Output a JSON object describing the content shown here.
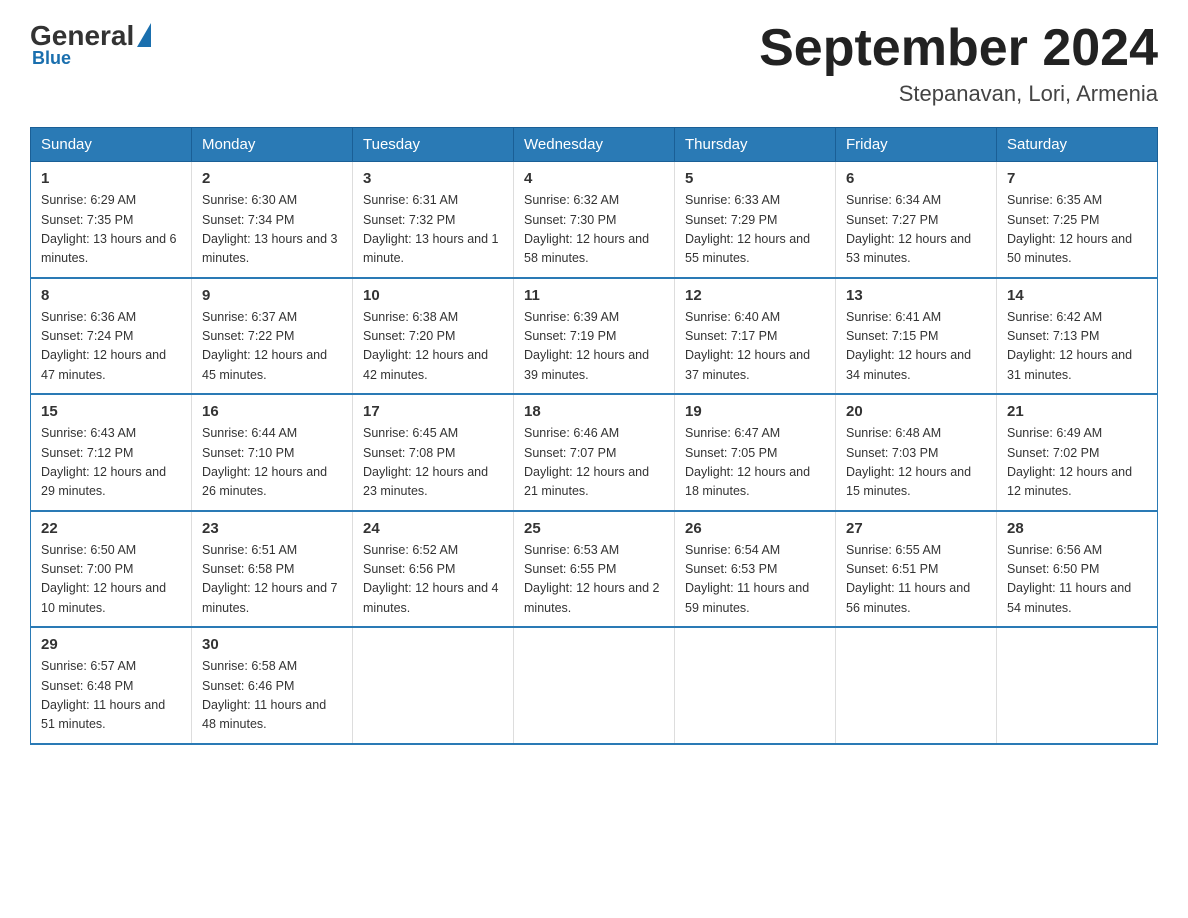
{
  "logo": {
    "general": "General",
    "blue": "Blue",
    "subtitle": "Blue"
  },
  "title": {
    "month_year": "September 2024",
    "location": "Stepanavan, Lori, Armenia"
  },
  "header_days": [
    "Sunday",
    "Monday",
    "Tuesday",
    "Wednesday",
    "Thursday",
    "Friday",
    "Saturday"
  ],
  "weeks": [
    [
      {
        "day": "1",
        "sunrise": "6:29 AM",
        "sunset": "7:35 PM",
        "daylight": "13 hours and 6 minutes."
      },
      {
        "day": "2",
        "sunrise": "6:30 AM",
        "sunset": "7:34 PM",
        "daylight": "13 hours and 3 minutes."
      },
      {
        "day": "3",
        "sunrise": "6:31 AM",
        "sunset": "7:32 PM",
        "daylight": "13 hours and 1 minute."
      },
      {
        "day": "4",
        "sunrise": "6:32 AM",
        "sunset": "7:30 PM",
        "daylight": "12 hours and 58 minutes."
      },
      {
        "day": "5",
        "sunrise": "6:33 AM",
        "sunset": "7:29 PM",
        "daylight": "12 hours and 55 minutes."
      },
      {
        "day": "6",
        "sunrise": "6:34 AM",
        "sunset": "7:27 PM",
        "daylight": "12 hours and 53 minutes."
      },
      {
        "day": "7",
        "sunrise": "6:35 AM",
        "sunset": "7:25 PM",
        "daylight": "12 hours and 50 minutes."
      }
    ],
    [
      {
        "day": "8",
        "sunrise": "6:36 AM",
        "sunset": "7:24 PM",
        "daylight": "12 hours and 47 minutes."
      },
      {
        "day": "9",
        "sunrise": "6:37 AM",
        "sunset": "7:22 PM",
        "daylight": "12 hours and 45 minutes."
      },
      {
        "day": "10",
        "sunrise": "6:38 AM",
        "sunset": "7:20 PM",
        "daylight": "12 hours and 42 minutes."
      },
      {
        "day": "11",
        "sunrise": "6:39 AM",
        "sunset": "7:19 PM",
        "daylight": "12 hours and 39 minutes."
      },
      {
        "day": "12",
        "sunrise": "6:40 AM",
        "sunset": "7:17 PM",
        "daylight": "12 hours and 37 minutes."
      },
      {
        "day": "13",
        "sunrise": "6:41 AM",
        "sunset": "7:15 PM",
        "daylight": "12 hours and 34 minutes."
      },
      {
        "day": "14",
        "sunrise": "6:42 AM",
        "sunset": "7:13 PM",
        "daylight": "12 hours and 31 minutes."
      }
    ],
    [
      {
        "day": "15",
        "sunrise": "6:43 AM",
        "sunset": "7:12 PM",
        "daylight": "12 hours and 29 minutes."
      },
      {
        "day": "16",
        "sunrise": "6:44 AM",
        "sunset": "7:10 PM",
        "daylight": "12 hours and 26 minutes."
      },
      {
        "day": "17",
        "sunrise": "6:45 AM",
        "sunset": "7:08 PM",
        "daylight": "12 hours and 23 minutes."
      },
      {
        "day": "18",
        "sunrise": "6:46 AM",
        "sunset": "7:07 PM",
        "daylight": "12 hours and 21 minutes."
      },
      {
        "day": "19",
        "sunrise": "6:47 AM",
        "sunset": "7:05 PM",
        "daylight": "12 hours and 18 minutes."
      },
      {
        "day": "20",
        "sunrise": "6:48 AM",
        "sunset": "7:03 PM",
        "daylight": "12 hours and 15 minutes."
      },
      {
        "day": "21",
        "sunrise": "6:49 AM",
        "sunset": "7:02 PM",
        "daylight": "12 hours and 12 minutes."
      }
    ],
    [
      {
        "day": "22",
        "sunrise": "6:50 AM",
        "sunset": "7:00 PM",
        "daylight": "12 hours and 10 minutes."
      },
      {
        "day": "23",
        "sunrise": "6:51 AM",
        "sunset": "6:58 PM",
        "daylight": "12 hours and 7 minutes."
      },
      {
        "day": "24",
        "sunrise": "6:52 AM",
        "sunset": "6:56 PM",
        "daylight": "12 hours and 4 minutes."
      },
      {
        "day": "25",
        "sunrise": "6:53 AM",
        "sunset": "6:55 PM",
        "daylight": "12 hours and 2 minutes."
      },
      {
        "day": "26",
        "sunrise": "6:54 AM",
        "sunset": "6:53 PM",
        "daylight": "11 hours and 59 minutes."
      },
      {
        "day": "27",
        "sunrise": "6:55 AM",
        "sunset": "6:51 PM",
        "daylight": "11 hours and 56 minutes."
      },
      {
        "day": "28",
        "sunrise": "6:56 AM",
        "sunset": "6:50 PM",
        "daylight": "11 hours and 54 minutes."
      }
    ],
    [
      {
        "day": "29",
        "sunrise": "6:57 AM",
        "sunset": "6:48 PM",
        "daylight": "11 hours and 51 minutes."
      },
      {
        "day": "30",
        "sunrise": "6:58 AM",
        "sunset": "6:46 PM",
        "daylight": "11 hours and 48 minutes."
      },
      null,
      null,
      null,
      null,
      null
    ]
  ]
}
